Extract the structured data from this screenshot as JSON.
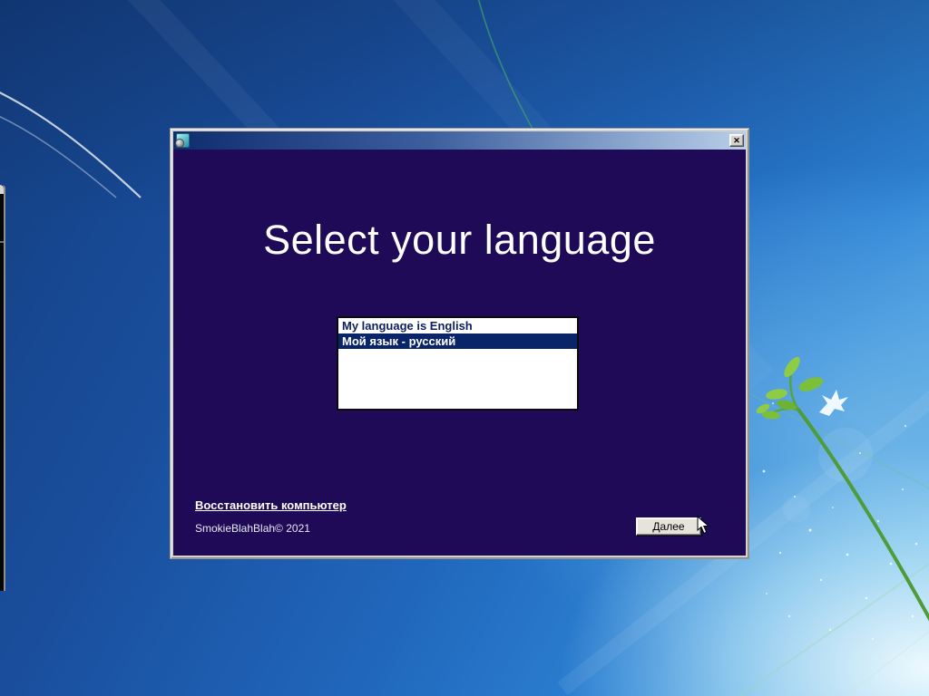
{
  "window": {
    "title_bar": {
      "title": "",
      "close_icon_glyph": "✕"
    },
    "heading": "Select your language",
    "language_list": [
      {
        "label": "My language is English",
        "selected": false
      },
      {
        "label": "Мой язык - русский",
        "selected": true
      }
    ],
    "recover_link_label": "Восстановить компьютер",
    "copyright_text": "SmokieBlahBlah© 2021",
    "next_button_label": "Далее"
  },
  "colors": {
    "window_body": "#1e0a57",
    "titlebar_gradient_start": "#0f2d6e",
    "titlebar_gradient_end": "#b9cfe9",
    "list_selection_bg": "#0a246a",
    "list_text": "#0c1f5e",
    "button_face": "#e6e3dc",
    "wallpaper_base": "#2066bb"
  }
}
